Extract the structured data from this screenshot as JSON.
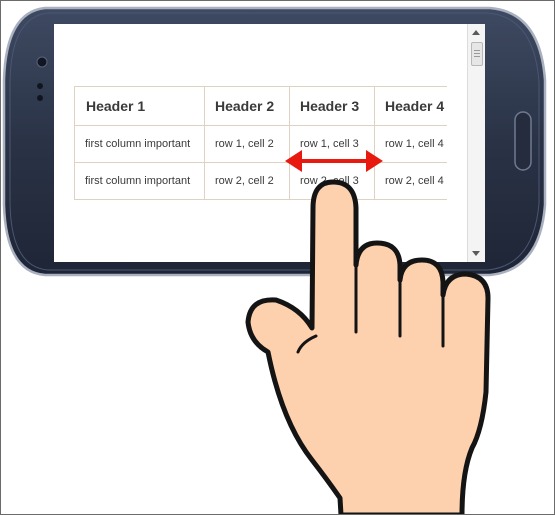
{
  "table": {
    "headers": [
      "Header 1",
      "Header 2",
      "Header 3",
      "Header 4"
    ],
    "rows": [
      [
        "first column important",
        "row 1, cell 2",
        "row 1, cell 3",
        "row 1, cell 4"
      ],
      [
        "first column important",
        "row 2, cell 2",
        "row 2, cell 3",
        "row 2, cell 4"
      ]
    ]
  },
  "colors": {
    "phone_body": "#2b3447",
    "swipe_arrow": "#e8190e",
    "hand_skin": "#fdd0ae"
  },
  "icons": [
    "swipe-arrow-icon",
    "hand-icon",
    "scroll-up-icon",
    "scroll-down-icon"
  ]
}
